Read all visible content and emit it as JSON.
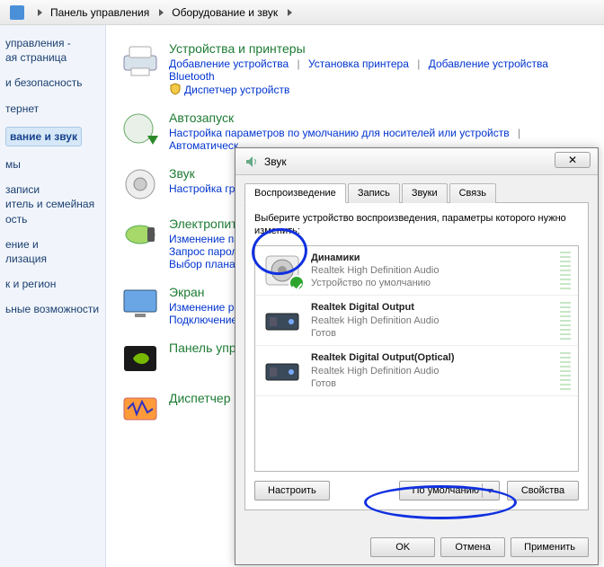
{
  "breadcrumb": {
    "items": [
      "Панель управления",
      "Оборудование и звук"
    ]
  },
  "sidebar": {
    "i0a": "управления -",
    "i0b": "ая страница",
    "i1": "и безопасность",
    "i2": "тернет",
    "i3": "вание и звук",
    "i4": "мы",
    "i5a": "записи",
    "i5b": "итель и семейная",
    "i5c": "ость",
    "i6a": "ение и",
    "i6b": "лизация",
    "i7": "к и регион",
    "i8": "ьные возможности"
  },
  "cats": {
    "printers": {
      "title": "Устройства и принтеры",
      "l1": "Добавление устройства",
      "l2": "Установка принтера",
      "l3": "Добавление устройства Bluetooth",
      "l4": "Диспетчер устройств"
    },
    "autoplay": {
      "title": "Автозапуск",
      "l1": "Настройка параметров по умолчанию для носителей или устройств",
      "l2": "Автоматическ"
    },
    "sound": {
      "title": "Звук",
      "l1": "Настройка гро"
    },
    "power": {
      "title": "Электропита",
      "l1": "Изменение пар",
      "l2": "Запрос пароля",
      "l3": "Выбор плана э"
    },
    "display": {
      "title": "Экран",
      "l1": "Изменение раз",
      "l2": "Подключение"
    },
    "nvidia": {
      "title": "Панель упр"
    },
    "dispatcher": {
      "title": "Диспетчер"
    }
  },
  "dialog": {
    "title": "Звук",
    "close": "✕",
    "tabs": [
      "Воспроизведение",
      "Запись",
      "Звуки",
      "Связь"
    ],
    "instruction": "Выберите устройство воспроизведения, параметры которого нужно изменить:",
    "devices": [
      {
        "name": "Динамики",
        "desc": "Realtek High Definition Audio",
        "status": "Устройство по умолчанию",
        "default": true,
        "kind": "speaker"
      },
      {
        "name": "Realtek Digital Output",
        "desc": "Realtek High Definition Audio",
        "status": "Готов",
        "default": false,
        "kind": "box"
      },
      {
        "name": "Realtek Digital Output(Optical)",
        "desc": "Realtek High Definition Audio",
        "status": "Готов",
        "default": false,
        "kind": "box"
      }
    ],
    "btn_configure": "Настроить",
    "btn_default": "По умолчанию",
    "btn_props": "Свойства",
    "btn_ok": "OK",
    "btn_cancel": "Отмена",
    "btn_apply": "Применить"
  }
}
